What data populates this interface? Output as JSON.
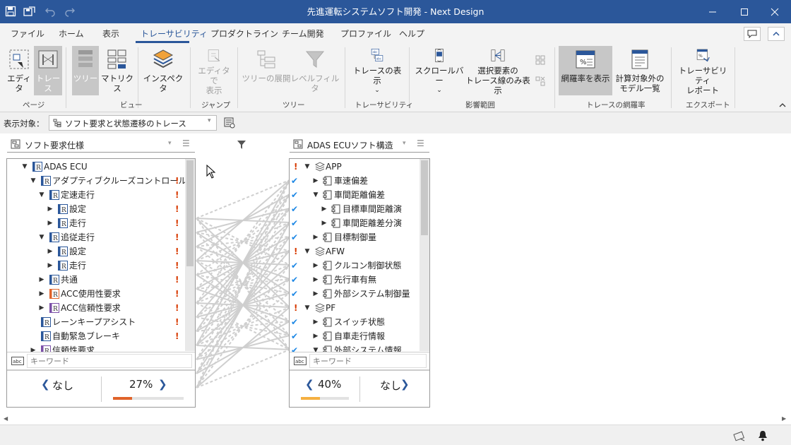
{
  "window": {
    "title": "先進運転システムソフト開発 - Next Design"
  },
  "menu": {
    "tabs": [
      "ファイル",
      "ホーム",
      "表示",
      "トレーサビリティ",
      "プロダクトライン",
      "チーム開発",
      "プロファイル",
      "ヘルプ"
    ],
    "active_tab": "トレーサビリティ"
  },
  "ribbon": {
    "buttons": {
      "editor": "エディタ",
      "trace": "トレース",
      "tree": "ツリー",
      "matrix": "マトリクス",
      "inspector": "インスペクタ",
      "jump_editor_1": "エディタで",
      "jump_editor_2": "表示",
      "expand_tree": "ツリーの展開",
      "level_filter": "レベルフィルタ",
      "show_trace": "トレースの表示",
      "scrollbar": "スクロールバー",
      "selected_only_1": "選択要素の",
      "selected_only_2": "トレース線のみ表示",
      "show_coverage": "網羅率を表示",
      "excluded_1": "計算対象外の",
      "excluded_2": "モデル一覧",
      "trace_report_1": "トレーサビリティ",
      "trace_report_2": "レポート"
    },
    "groups": {
      "page": "ページ",
      "view": "ビュー",
      "jump": "ジャンプ",
      "tree": "ツリー",
      "traceability": "トレーサビリティ",
      "impact": "影響範囲",
      "coverage": "トレースの網羅率",
      "export": "エクスポート"
    }
  },
  "target": {
    "label": "表示対象：",
    "value": "ソフト要求と状態遷移のトレース"
  },
  "left_panel": {
    "title": "ソフト要求仕様",
    "rows": [
      {
        "label": "ADAS ECU",
        "level": 0,
        "caret": "down",
        "flag": false
      },
      {
        "label": "アダプティブクルーズコントロール",
        "level": 1,
        "caret": "down",
        "flag": true
      },
      {
        "label": "定速走行",
        "level": 2,
        "caret": "down",
        "flag": true
      },
      {
        "label": "設定",
        "level": 3,
        "caret": "right",
        "flag": true
      },
      {
        "label": "走行",
        "level": 3,
        "caret": "right",
        "flag": true
      },
      {
        "label": "追従走行",
        "level": 2,
        "caret": "down",
        "flag": true
      },
      {
        "label": "設定",
        "level": 3,
        "caret": "right",
        "flag": true
      },
      {
        "label": "走行",
        "level": 3,
        "caret": "right",
        "flag": true
      },
      {
        "label": "共通",
        "level": 2,
        "caret": "right",
        "flag": true
      },
      {
        "label": "ACC使用性要求",
        "level": 2,
        "caret": "right",
        "flag": true,
        "variant": "orange"
      },
      {
        "label": "ACC信頼性要求",
        "level": 2,
        "caret": "right",
        "flag": true,
        "variant": "purple"
      },
      {
        "label": "レーンキープアシスト",
        "level": 1,
        "caret": "none",
        "flag": true
      },
      {
        "label": "自動緊急ブレーキ",
        "level": 1,
        "caret": "none",
        "flag": true
      },
      {
        "label": "信頼性要求",
        "level": 1,
        "caret": "right",
        "flag": false,
        "variant": "purple"
      }
    ],
    "keyword_placeholder": "キーワード",
    "coverage": {
      "left": "なし",
      "right": "27%",
      "progress": 0.27,
      "bar_color": "#e0632a"
    }
  },
  "right_panel": {
    "title": "ADAS ECUソフト構造",
    "rows": [
      {
        "label": "APP",
        "level": 0,
        "caret": "down",
        "mark": "ex",
        "kind": "pkg"
      },
      {
        "label": "車速偏差",
        "level": 1,
        "caret": "right",
        "mark": "check",
        "kind": "comp"
      },
      {
        "label": "車間距離偏差",
        "level": 1,
        "caret": "down",
        "mark": "check",
        "kind": "comp"
      },
      {
        "label": "目標車間距離演",
        "level": 2,
        "caret": "right",
        "mark": "check",
        "kind": "comp"
      },
      {
        "label": "車間距離差分演",
        "level": 2,
        "caret": "right",
        "mark": "check",
        "kind": "comp"
      },
      {
        "label": "目標制御量",
        "level": 1,
        "caret": "right",
        "mark": "check",
        "kind": "comp"
      },
      {
        "label": "AFW",
        "level": 0,
        "caret": "down",
        "mark": "ex",
        "kind": "pkg"
      },
      {
        "label": "クルコン制御状態",
        "level": 1,
        "caret": "right",
        "mark": "check",
        "kind": "comp"
      },
      {
        "label": "先行車有無",
        "level": 1,
        "caret": "right",
        "mark": "check",
        "kind": "comp"
      },
      {
        "label": "外部システム制御量",
        "level": 1,
        "caret": "right",
        "mark": "check",
        "kind": "comp"
      },
      {
        "label": "PF",
        "level": 0,
        "caret": "down",
        "mark": "ex",
        "kind": "pkg"
      },
      {
        "label": "スイッチ状態",
        "level": 1,
        "caret": "right",
        "mark": "check",
        "kind": "comp"
      },
      {
        "label": "自車走行情報",
        "level": 1,
        "caret": "right",
        "mark": "check",
        "kind": "comp"
      },
      {
        "label": "外部システム情報",
        "level": 1,
        "caret": "down",
        "mark": "check",
        "kind": "comp"
      }
    ],
    "keyword_placeholder": "キーワード",
    "coverage": {
      "left": "40%",
      "right": "なし",
      "progress": 0.4,
      "bar_color": "#f5b041"
    }
  },
  "colors": {
    "accent": "#2b579a",
    "error": "#d83b01",
    "check": "#1e88e5"
  }
}
